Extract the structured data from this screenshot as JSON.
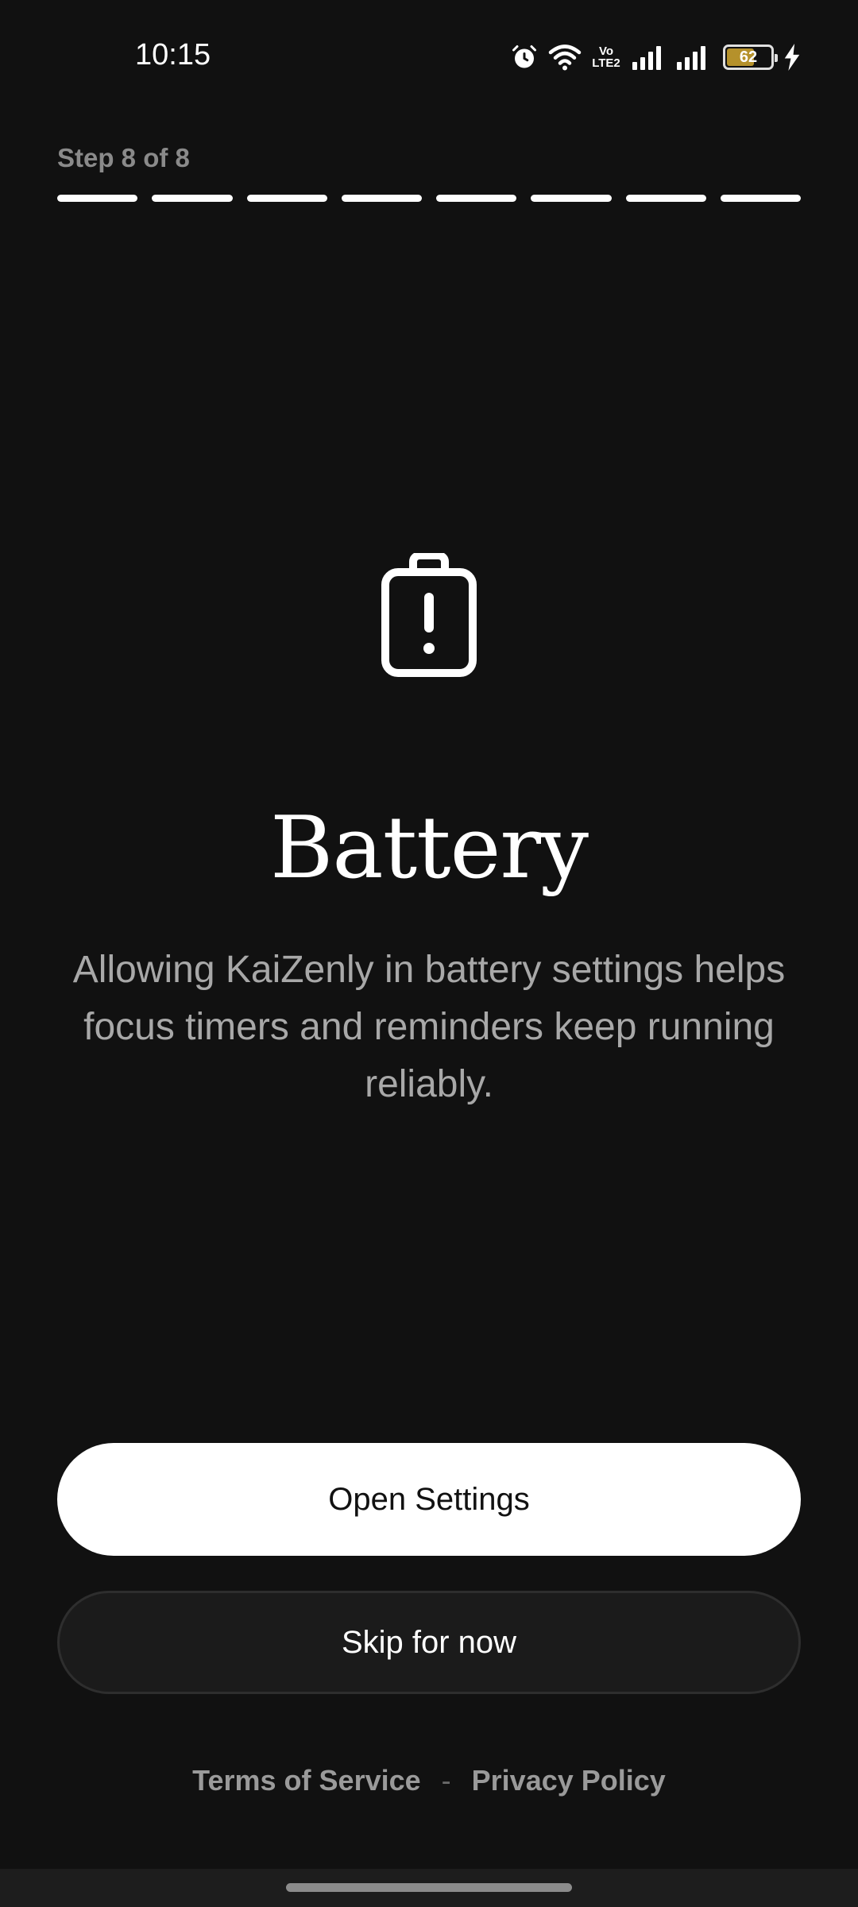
{
  "status_bar": {
    "time": "10:15",
    "network_label_top": "Vo",
    "network_label_bottom": "LTE2",
    "battery_level": "62",
    "icons": [
      "alarm-icon",
      "wifi-icon",
      "volte-icon",
      "signal-icon",
      "signal-icon",
      "battery-icon",
      "charging-icon"
    ]
  },
  "progress": {
    "label": "Step 8 of 8",
    "current_step": 8,
    "total_steps": 8
  },
  "content": {
    "icon": "battery-alert-icon",
    "title": "Battery",
    "description": "Allowing KaiZenly in battery settings helps focus timers and reminders keep running reliably."
  },
  "actions": {
    "primary_label": "Open Settings",
    "secondary_label": "Skip for now"
  },
  "footer": {
    "terms_label": "Terms of Service",
    "separator": "-",
    "privacy_label": "Privacy Policy"
  },
  "colors": {
    "background": "#111111",
    "primary_button": "#ffffff",
    "secondary_button": "#1b1b1b",
    "muted_text": "#a8a8a8",
    "battery_fill": "#b5912b"
  }
}
